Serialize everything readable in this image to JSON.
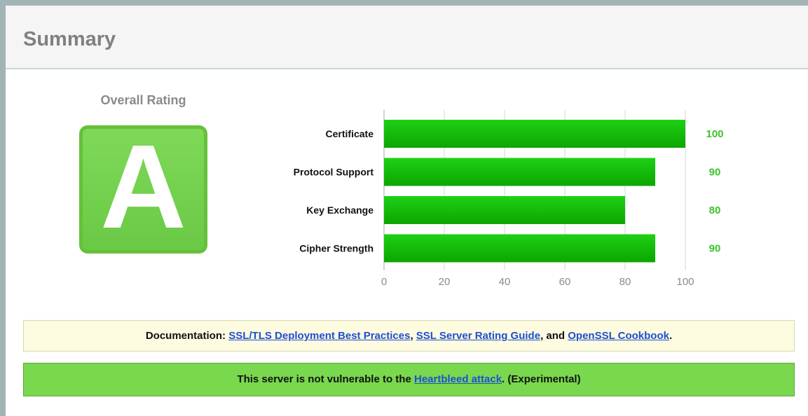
{
  "header": {
    "title": "Summary"
  },
  "rating": {
    "label": "Overall Rating",
    "grade": "A"
  },
  "chart_data": {
    "type": "bar",
    "orientation": "horizontal",
    "categories": [
      "Certificate",
      "Protocol Support",
      "Key Exchange",
      "Cipher Strength"
    ],
    "values": [
      100,
      90,
      80,
      90
    ],
    "value_labels": [
      "100",
      "90",
      "80",
      "90"
    ],
    "xlim": [
      0,
      100
    ],
    "xticks": [
      0,
      20,
      40,
      60,
      80,
      100
    ],
    "xtick_labels": [
      "0",
      "20",
      "40",
      "60",
      "80",
      "100"
    ],
    "grid": true,
    "colors": {
      "bar_top": "#1ed015",
      "bar_bottom": "#0ca600",
      "value_label": "#3cc32a"
    }
  },
  "documentation": {
    "prefix": "Documentation: ",
    "link1": "SSL/TLS Deployment Best Practices",
    "sep1": ", ",
    "link2": "SSL Server Rating Guide",
    "sep2": ", and ",
    "link3": "OpenSSL Cookbook",
    "suffix": "."
  },
  "heartbleed": {
    "prefix": "This server is not vulnerable to the ",
    "link": "Heartbleed attack",
    "suffix": ". (Experimental)"
  }
}
